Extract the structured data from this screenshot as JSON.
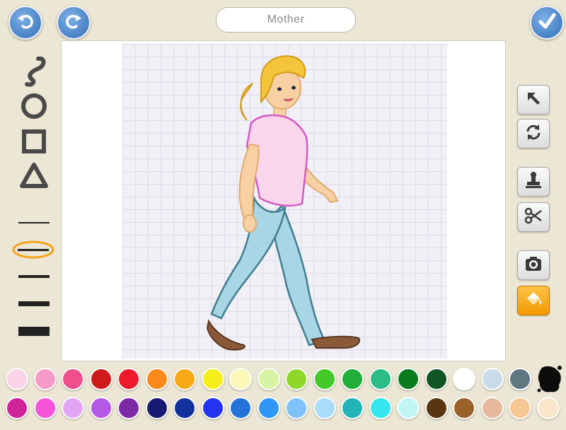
{
  "header": {
    "title": "Mother"
  },
  "icons": {
    "undo": "undo-icon",
    "redo": "redo-icon",
    "done": "checkmark-icon",
    "tools_left": [
      "freehand-icon",
      "circle-icon",
      "square-icon",
      "triangle-icon"
    ],
    "tools_right": [
      "select-arrow-icon",
      "rotate-icon",
      "stamp-icon",
      "scissors-icon",
      "camera-icon",
      "paint-bucket-icon"
    ]
  },
  "line_widths": {
    "options": [
      "thin",
      "medium-thin",
      "medium",
      "thick",
      "extra-thick"
    ],
    "selected": "medium-thin"
  },
  "colors": {
    "accent": "#f5a21a",
    "row1": [
      "#fbd3e6",
      "#f79ac8",
      "#ef4f8b",
      "#cf1a1a",
      "#f11a2d",
      "#f98a1a",
      "#f9a915",
      "#f4ee1a",
      "#fbf8b8",
      "#d8f3a4",
      "#8fd82a",
      "#45c92a",
      "#20ad3a",
      "#2cbc85",
      "#0b7c1d",
      "#0f5622",
      "#ffffff",
      "#c8dbe9",
      "#5e7780"
    ],
    "row2": [
      "#d2239a",
      "#f754da",
      "#e2a5f4",
      "#b557e7",
      "#7d2aa8",
      "#181b73",
      "#13319c",
      "#2434ee",
      "#2372d9",
      "#2e98f4",
      "#7fc2f9",
      "#a8dcf9",
      "#22b4b7",
      "#34e6ee",
      "#c0f6f6",
      "#5a3512",
      "#9b612b",
      "#e6b99c",
      "#f8c894",
      "#fbe6cb"
    ],
    "ink_blob": "#0d0d0d"
  }
}
